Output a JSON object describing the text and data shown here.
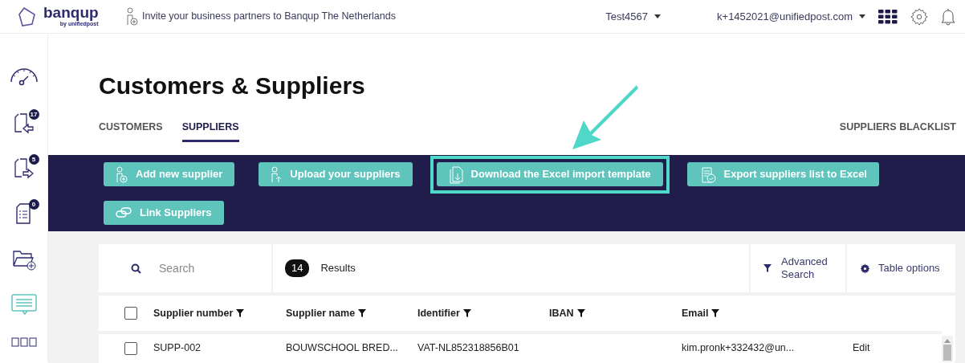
{
  "topbar": {
    "logo": {
      "name": "banqup",
      "tagline": "by unifiedpost"
    },
    "invite": "Invite your business partners to Banqup The Netherlands",
    "company": "Test4567",
    "user": "k+1452021@unifiedpost.com"
  },
  "sidebar": {
    "items": [
      {
        "kind": "dashboard",
        "selected": false
      },
      {
        "kind": "inbound",
        "badge": "17",
        "selected": false
      },
      {
        "kind": "outbound",
        "badge": "5",
        "selected": false
      },
      {
        "kind": "document",
        "badge": "0",
        "selected": false
      },
      {
        "kind": "folder",
        "selected": false
      },
      {
        "kind": "chat",
        "selected": true
      },
      {
        "kind": "apps",
        "selected": false
      }
    ]
  },
  "page": {
    "title": "Customers & Suppliers",
    "tabs": [
      {
        "label": "CUSTOMERS",
        "selected": false
      },
      {
        "label": "SUPPLIERS",
        "selected": true
      }
    ],
    "blacklist_link": "SUPPLIERS BLACKLIST"
  },
  "actions": [
    {
      "label": "Add new supplier",
      "highlighted": false
    },
    {
      "label": "Upload your suppliers",
      "highlighted": false
    },
    {
      "label": "Download the Excel import template",
      "highlighted": true
    },
    {
      "label": "Export suppliers list to Excel",
      "highlighted": false
    },
    {
      "label": "Link Suppliers",
      "highlighted": false
    }
  ],
  "toolbar": {
    "search": {
      "placeholder": "Search"
    },
    "count": "14",
    "count_label": "Results",
    "advanced_search": "Advanced Search",
    "table_options": "Table options"
  },
  "table": {
    "select_all": {
      "checked": false
    },
    "columns": [
      {
        "label": "Supplier number"
      },
      {
        "label": "Supplier name"
      },
      {
        "label": "Identifier"
      },
      {
        "label": "IBAN"
      },
      {
        "label": "Email"
      }
    ],
    "rows": [
      {
        "checked": false,
        "supplier_number": "SUPP-002",
        "supplier_name": "BOUWSCHOOL BRED...",
        "identifier": "VAT-NL852318856B01",
        "email": "kim.pronk+332432@un...",
        "action": "Edit"
      }
    ]
  }
}
